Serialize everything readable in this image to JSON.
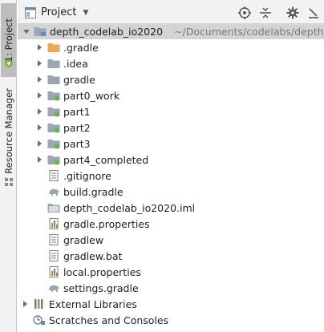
{
  "side_strip": {
    "project_tab_label": "1: Project",
    "resource_tab_label": "Resource Manager"
  },
  "header": {
    "title": "Project",
    "tools": [
      "globe-target-icon",
      "collapse-all-icon",
      "gear-icon",
      "hide-panel-icon"
    ]
  },
  "tree": {
    "root": {
      "name": "depth_codelab_io2020",
      "path": "~/Documents/codelabs/depth_c"
    },
    "children": [
      {
        "name": ".gradle",
        "kind": "folder-orange",
        "expandable": true
      },
      {
        "name": ".idea",
        "kind": "folder",
        "expandable": true
      },
      {
        "name": "gradle",
        "kind": "folder",
        "expandable": true
      },
      {
        "name": "part0_work",
        "kind": "module",
        "expandable": true
      },
      {
        "name": "part1",
        "kind": "module",
        "expandable": true
      },
      {
        "name": "part2",
        "kind": "module",
        "expandable": true
      },
      {
        "name": "part3",
        "kind": "module",
        "expandable": true
      },
      {
        "name": "part4_completed",
        "kind": "module",
        "expandable": true
      },
      {
        "name": ".gitignore",
        "kind": "text-file",
        "expandable": false
      },
      {
        "name": "build.gradle",
        "kind": "gradle-file",
        "expandable": false
      },
      {
        "name": "depth_codelab_io2020.iml",
        "kind": "iml-file",
        "expandable": false
      },
      {
        "name": "gradle.properties",
        "kind": "properties-file",
        "expandable": false
      },
      {
        "name": "gradlew",
        "kind": "text-file",
        "expandable": false
      },
      {
        "name": "gradlew.bat",
        "kind": "text-file",
        "expandable": false
      },
      {
        "name": "local.properties",
        "kind": "properties-file",
        "expandable": false
      },
      {
        "name": "settings.gradle",
        "kind": "gradle-file",
        "expandable": false
      }
    ],
    "external_libraries": "External Libraries",
    "scratches": "Scratches and Consoles"
  }
}
